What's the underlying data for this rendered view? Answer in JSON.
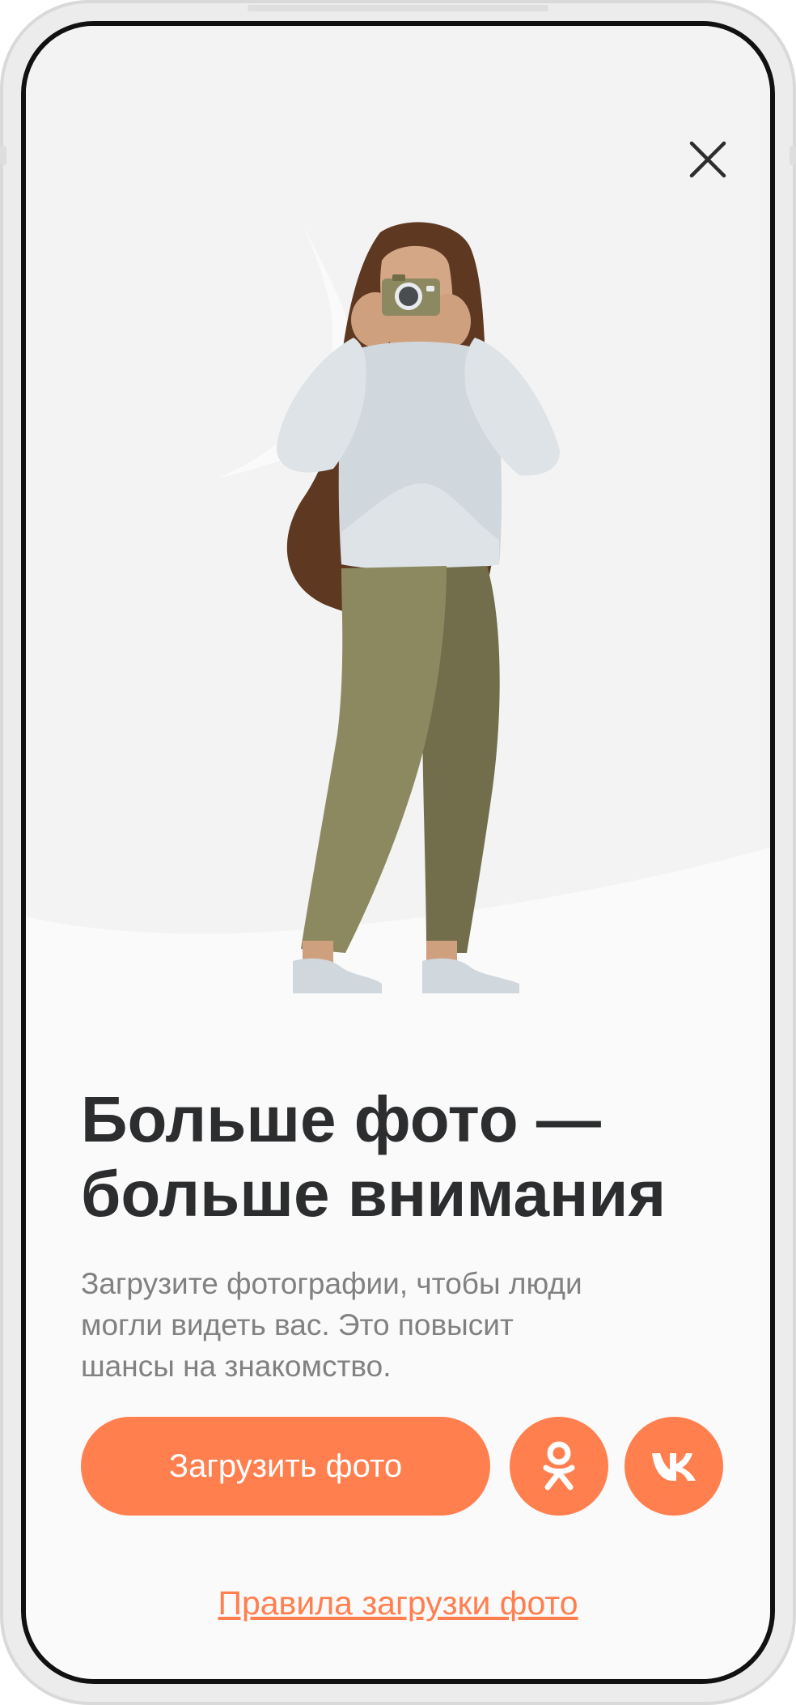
{
  "modal": {
    "close_icon": "close-icon",
    "title_line1": "Больше фото —",
    "title_line2": "больше внимания",
    "subtitle_line1": "Загрузите фотографии, чтобы люди",
    "subtitle_line2": "могли видеть вас. Это повысит",
    "subtitle_line3": "шансы на знакомство.",
    "upload_button_label": "Загрузить фото",
    "ok_icon": "odnoklassniki-icon",
    "vk_icon": "vk-icon",
    "rules_link_label": "Правила загрузки фото"
  },
  "colors": {
    "accent": "#ff7f4f",
    "title": "#2c2d2e",
    "subtitle": "#818181",
    "background": "#fafafa",
    "backdrop_shape": "#f3f3f3"
  }
}
